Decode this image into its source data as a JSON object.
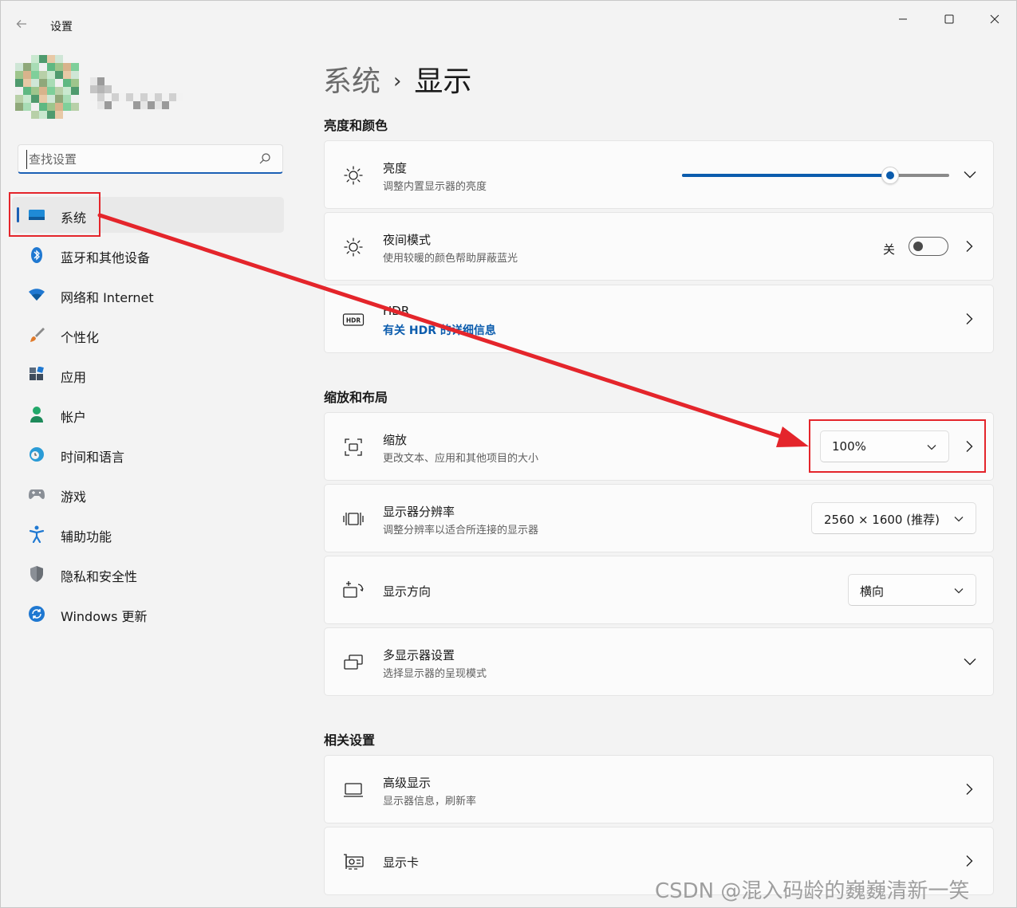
{
  "window": {
    "title": "设置"
  },
  "search": {
    "placeholder": "查找设置"
  },
  "sidebar": {
    "items": [
      {
        "label": "系统",
        "icon": "monitor-icon",
        "active": true
      },
      {
        "label": "蓝牙和其他设备",
        "icon": "bluetooth-icon"
      },
      {
        "label": "网络和 Internet",
        "icon": "wifi-icon"
      },
      {
        "label": "个性化",
        "icon": "brush-icon"
      },
      {
        "label": "应用",
        "icon": "apps-icon"
      },
      {
        "label": "帐户",
        "icon": "person-icon"
      },
      {
        "label": "时间和语言",
        "icon": "globe-clock-icon"
      },
      {
        "label": "游戏",
        "icon": "gamepad-icon"
      },
      {
        "label": "辅助功能",
        "icon": "accessibility-icon"
      },
      {
        "label": "隐私和安全性",
        "icon": "shield-icon"
      },
      {
        "label": "Windows 更新",
        "icon": "update-icon"
      }
    ]
  },
  "breadcrumb": {
    "parent": "系统",
    "separator": "›",
    "current": "显示"
  },
  "sections": {
    "brightness_color": {
      "title": "亮度和颜色",
      "brightness": {
        "title": "亮度",
        "subtitle": "调整内置显示器的亮度",
        "value_fraction": 0.78
      },
      "night_light": {
        "title": "夜间模式",
        "subtitle": "使用较暖的颜色帮助屏蔽蓝光",
        "state_label": "关",
        "on": false
      },
      "hdr": {
        "title": "HDR",
        "link": "有关 HDR 的详细信息"
      }
    },
    "scale_layout": {
      "title": "缩放和布局",
      "scale": {
        "title": "缩放",
        "subtitle": "更改文本、应用和其他项目的大小",
        "value": "100%"
      },
      "resolution": {
        "title": "显示器分辨率",
        "subtitle": "调整分辨率以适合所连接的显示器",
        "value": "2560 × 1600 (推荐)"
      },
      "orientation": {
        "title": "显示方向",
        "value": "横向"
      },
      "multi_display": {
        "title": "多显示器设置",
        "subtitle": "选择显示器的呈现模式"
      }
    },
    "related": {
      "title": "相关设置",
      "advanced": {
        "title": "高级显示",
        "subtitle": "显示器信息，刷新率"
      },
      "gpu": {
        "title": "显示卡"
      }
    }
  },
  "annotation": {
    "color": "#e4252b"
  },
  "accent_color": "#0b5cad",
  "watermark": "CSDN @混入码龄的巍巍清新一笑"
}
